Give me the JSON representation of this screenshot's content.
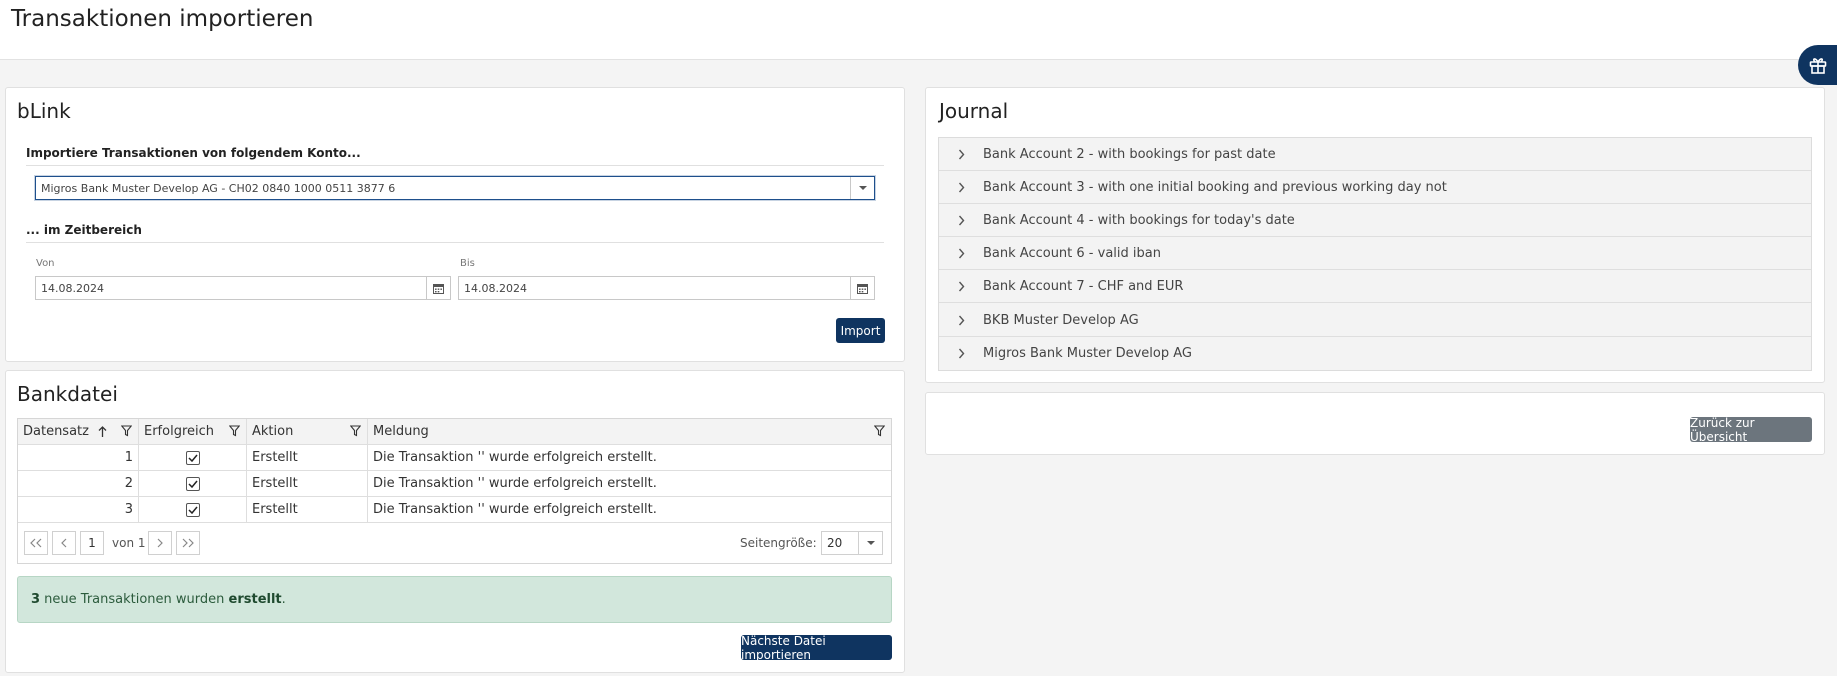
{
  "page": {
    "title": "Transaktionen importieren"
  },
  "blink": {
    "title": "bLink",
    "account_section_label": "Importiere Transaktionen von folgendem Konto...",
    "account_value": "Migros Bank Muster Develop AG - CH02 0840 1000 0511 3877 6",
    "time_section_label": "... im Zeitbereich",
    "from_label": "Von",
    "from_value": "14.08.2024",
    "to_label": "Bis",
    "to_value": "14.08.2024",
    "import_button": "Import"
  },
  "bankdatei": {
    "title": "Bankdatei",
    "columns": [
      "Datensatz",
      "Erfolgreich",
      "Aktion",
      "Meldung"
    ],
    "rows": [
      {
        "datensatz": "1",
        "erfolgreich": true,
        "aktion": "Erstellt",
        "meldung": "Die Transaktion '' wurde erfolgreich erstellt."
      },
      {
        "datensatz": "2",
        "erfolgreich": true,
        "aktion": "Erstellt",
        "meldung": "Die Transaktion '' wurde erfolgreich erstellt."
      },
      {
        "datensatz": "3",
        "erfolgreich": true,
        "aktion": "Erstellt",
        "meldung": "Die Transaktion '' wurde erfolgreich erstellt."
      }
    ],
    "pager": {
      "current_page": "1",
      "of_label": "von 1",
      "page_size_label": "Seitengröße:",
      "page_size": "20"
    },
    "alert": {
      "count": "3",
      "text_middle": " neue Transaktionen wurden ",
      "status": "erstellt",
      "suffix": "."
    },
    "next_button": "Nächste Datei importieren"
  },
  "journal": {
    "title": "Journal",
    "items": [
      "Bank Account 2 - with bookings for past date",
      "Bank Account 3 - with one initial booking and previous working day not",
      "Bank Account 4 - with bookings for today's date",
      "Bank Account 6 - valid iban",
      "Bank Account 7 - CHF and EUR",
      "BKB Muster Develop AG",
      "Migros Bank Muster Develop AG"
    ]
  },
  "back_button": "Zurück zur Übersicht",
  "colors": {
    "primary": "#0f3460",
    "secondary": "#6c757d",
    "success_bg": "#d2e7dc"
  },
  "icons": [
    "gift-icon",
    "chevron-down-icon",
    "calendar-icon",
    "sort-asc-icon",
    "filter-icon",
    "check-icon",
    "first-page-icon",
    "prev-page-icon",
    "next-page-icon",
    "last-page-icon",
    "chevron-right-icon"
  ]
}
